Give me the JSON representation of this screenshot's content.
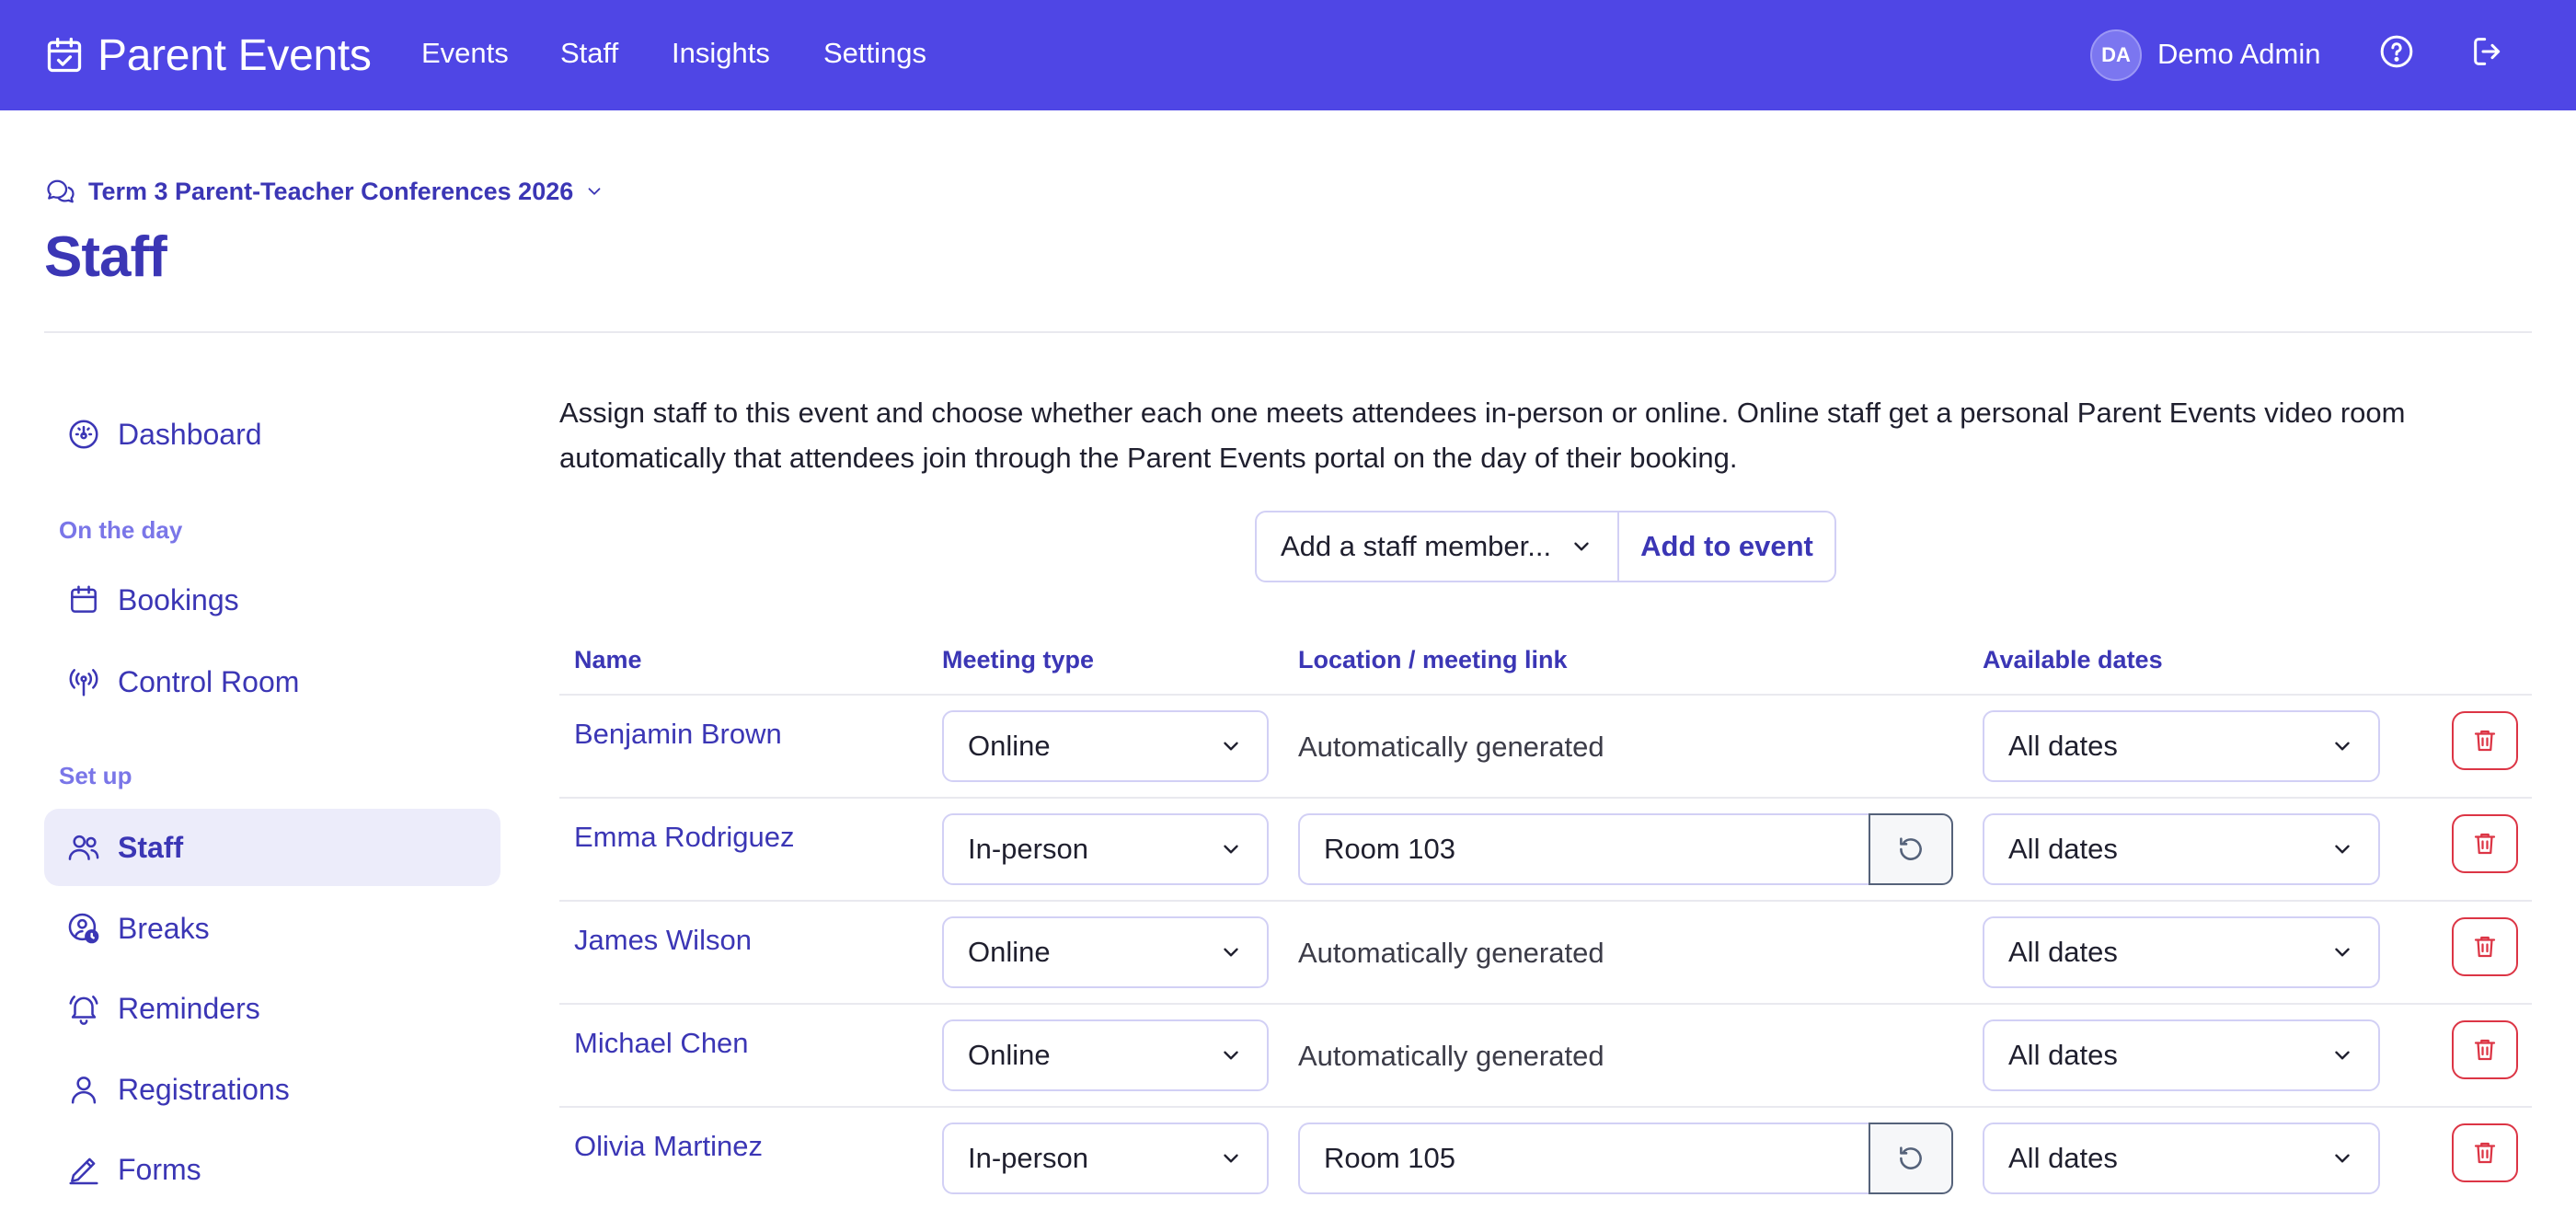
{
  "app": {
    "brand": "Parent Events",
    "nav": [
      "Events",
      "Staff",
      "Insights",
      "Settings"
    ],
    "user": {
      "initials": "DA",
      "name": "Demo Admin"
    },
    "colors": {
      "primary": "#4f46e5",
      "accent": "#3b36b5",
      "danger": "#dc3545"
    }
  },
  "header": {
    "event_name": "Term 3 Parent-Teacher Conferences 2026",
    "page_title": "Staff"
  },
  "sidebar": {
    "dashboard": "Dashboard",
    "section_on_the_day": "On the day",
    "bookings": "Bookings",
    "control_room": "Control Room",
    "section_set_up": "Set up",
    "staff": "Staff",
    "breaks": "Breaks",
    "reminders": "Reminders",
    "registrations": "Registrations",
    "forms": "Forms"
  },
  "main": {
    "intro": "Assign staff to this event and choose whether each one meets attendees in-person or online. Online staff get a personal Parent Events video room automatically that attendees join through the Parent Events portal on the day of their booking.",
    "add_placeholder": "Add a staff member...",
    "add_button": "Add to event",
    "columns": {
      "name": "Name",
      "meeting_type": "Meeting type",
      "location": "Location / meeting link",
      "dates": "Available dates"
    },
    "rows": [
      {
        "name": "Benjamin Brown",
        "meeting_type": "Online",
        "location": "Automatically generated",
        "dates": "All dates"
      },
      {
        "name": "Emma Rodriguez",
        "meeting_type": "In-person",
        "location": "Room 103",
        "dates": "All dates"
      },
      {
        "name": "James Wilson",
        "meeting_type": "Online",
        "location": "Automatically generated",
        "dates": "All dates"
      },
      {
        "name": "Michael Chen",
        "meeting_type": "Online",
        "location": "Automatically generated",
        "dates": "All dates"
      },
      {
        "name": "Olivia Martinez",
        "meeting_type": "In-person",
        "location": "Room 105",
        "dates": "All dates"
      }
    ]
  }
}
